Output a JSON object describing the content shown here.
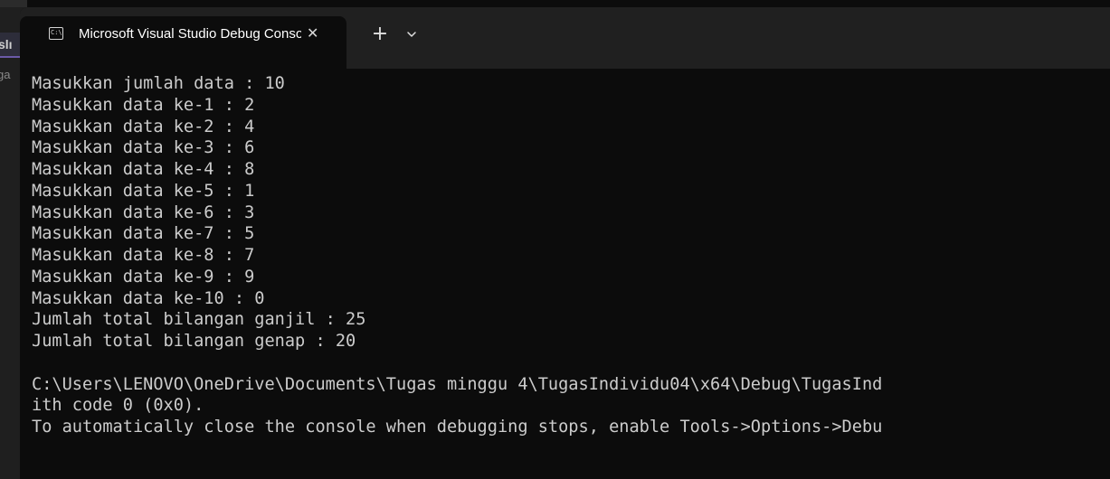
{
  "background_app": {
    "tab_fragment": "slı",
    "sub_fragment": "ga"
  },
  "terminal": {
    "tab": {
      "title": "Microsoft Visual Studio Debug Console",
      "icon": "console-icon",
      "close_glyph": "✕"
    },
    "new_tab_glyph": "+",
    "dropdown_icon": "chevron-down-icon",
    "colors": {
      "background": "#0c0c0c",
      "titlebar": "#202020",
      "text": "#cccccc"
    },
    "lines": [
      "Masukkan jumlah data : 10",
      "Masukkan data ke-1 : 2",
      "Masukkan data ke-2 : 4",
      "Masukkan data ke-3 : 6",
      "Masukkan data ke-4 : 8",
      "Masukkan data ke-5 : 1",
      "Masukkan data ke-6 : 3",
      "Masukkan data ke-7 : 5",
      "Masukkan data ke-8 : 7",
      "Masukkan data ke-9 : 9",
      "Masukkan data ke-10 : 0",
      "Jumlah total bilangan ganjil : 25",
      "Jumlah total bilangan genap : 20",
      "",
      "C:\\Users\\LENOVO\\OneDrive\\Documents\\Tugas minggu 4\\TugasIndividu04\\x64\\Debug\\TugasInd",
      "ith code 0 (0x0).",
      "To automatically close the console when debugging stops, enable Tools->Options->Debu"
    ]
  }
}
